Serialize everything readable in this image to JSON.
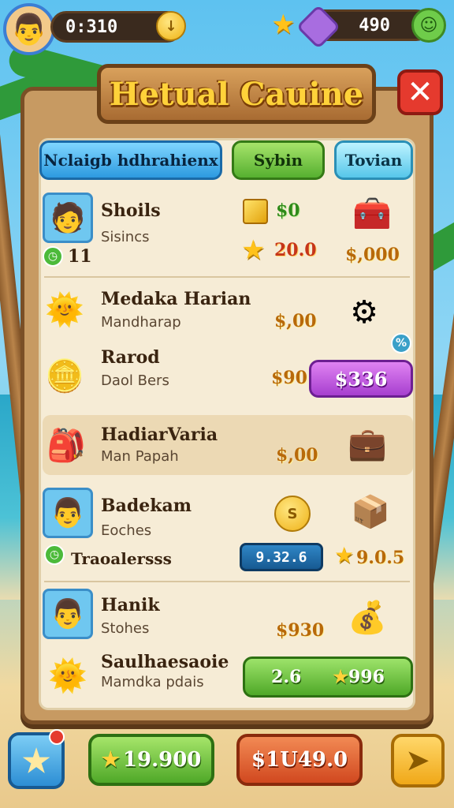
{
  "hud": {
    "player_timer": "0:310",
    "currency_value": "490",
    "avatar_icon": "👨",
    "coin_icon": "↓",
    "star_icon": "★",
    "menu_icon": "☺"
  },
  "window": {
    "title": "Hetual Cauine",
    "close_icon": "✕"
  },
  "tabs": [
    {
      "label": "Nclaigb hdhrahienx"
    },
    {
      "label": "Sybin"
    },
    {
      "label": "Tovian"
    }
  ],
  "rows": [
    {
      "name": "Shoils",
      "sub": "Sisincs",
      "badge": "11",
      "price_top": "$0",
      "price_bottom": "20.0",
      "price_right": "$,000"
    },
    {
      "name": "Medaka Harian",
      "sub": "Mandharap",
      "price": "$,00"
    },
    {
      "name": "Rarod",
      "sub": "Daol Bers",
      "price": "$90",
      "button": "$336"
    },
    {
      "name": "HadiarVaria",
      "sub": "Man Papah",
      "price": "$,00"
    },
    {
      "name": "Badekam",
      "sub": "Eoches",
      "extra": "Traoalersss",
      "button": "9.32.6",
      "price_star": "9.0.5"
    },
    {
      "name": "Hanik",
      "sub": "Stohes",
      "price": "$930"
    },
    {
      "name": "Saulhaesaoie",
      "sub": "Mamdka pdais",
      "button_left": "2.6",
      "button_right": "996"
    }
  ],
  "bottom": {
    "star_icon": "★",
    "green_label": "19.900",
    "red_label": "$1U49.0",
    "yellow_icon": "➤"
  }
}
